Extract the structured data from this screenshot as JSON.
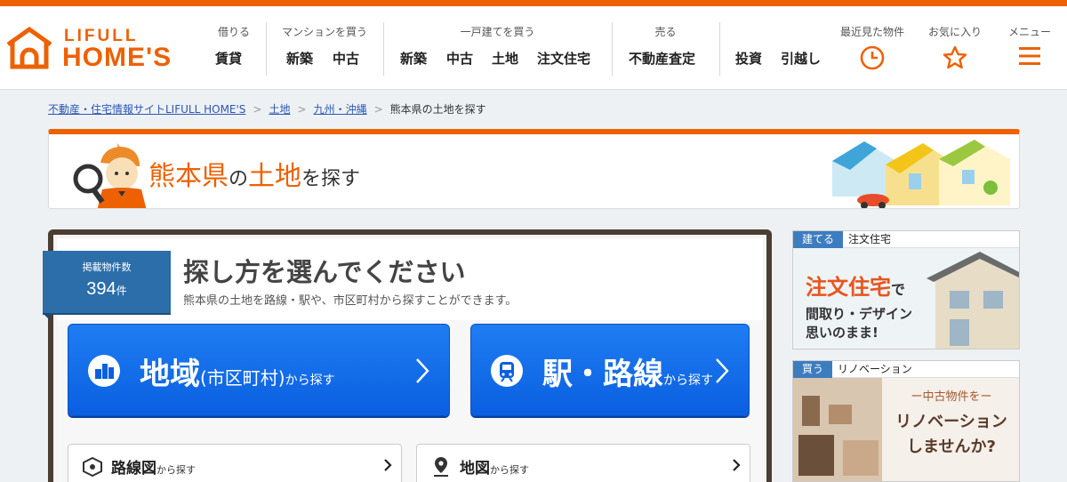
{
  "header": {
    "logo": {
      "line1": "LIFULL",
      "line2": "HOME'S"
    },
    "nav": [
      {
        "heading": "借りる",
        "items": [
          "賃貸"
        ]
      },
      {
        "heading": "マンションを買う",
        "items": [
          "新築",
          "中古"
        ]
      },
      {
        "heading": "一戸建てを買う",
        "items": [
          "新築",
          "中古",
          "土地",
          "注文住宅"
        ]
      },
      {
        "heading": "売る",
        "items": [
          "不動産査定"
        ]
      },
      {
        "heading": "",
        "items": [
          "投資",
          "引越し"
        ]
      }
    ],
    "icons": [
      {
        "label": "最近見た物件",
        "icon": "clock-icon"
      },
      {
        "label": "お気に入り",
        "icon": "star-icon"
      },
      {
        "label": "メニュー",
        "icon": "menu-icon"
      }
    ]
  },
  "breadcrumb": [
    {
      "label": "不動産・住宅情報サイトLIFULL HOME'S",
      "link": true
    },
    {
      "label": "土地",
      "link": true
    },
    {
      "label": "九州・沖縄",
      "link": true
    },
    {
      "label": "熊本県の土地を探す",
      "link": false
    }
  ],
  "banner": {
    "pref": "熊本県",
    "no": "の",
    "kind": "土地",
    "suffix": "を探す"
  },
  "count": {
    "label": "掲載物件数",
    "value": "394",
    "unit": "件"
  },
  "choose": {
    "title": "探し方を選んでください",
    "subtitle": "熊本県の土地を路線・駅や、市区町村から探すことができます。"
  },
  "buttons": {
    "area": {
      "main": "地域",
      "paren": "(市区町村)",
      "tail": "から探す"
    },
    "station": {
      "main": "駅・路線",
      "tail": "から探す"
    },
    "route_map": {
      "main": "路線図",
      "tail": "から探す"
    },
    "map": {
      "main": "地図",
      "tail": "から探す"
    }
  },
  "ads": [
    {
      "tag": "建てる",
      "label": "注文住宅",
      "headline1": "注文住宅",
      "headline1_tail": "で",
      "headline2": "間取り・デザイン",
      "headline3": "思いのまま!"
    },
    {
      "tag": "買う",
      "label": "リノベーション",
      "line1": "ー中古物件をー",
      "line2": "リノベーション",
      "line3": "しませんか?"
    }
  ],
  "colors": {
    "brand": "#ed6103",
    "button_blue": "#0a5fe0",
    "badge_blue": "#2b6ea9",
    "panel_border": "#4a3e33"
  }
}
